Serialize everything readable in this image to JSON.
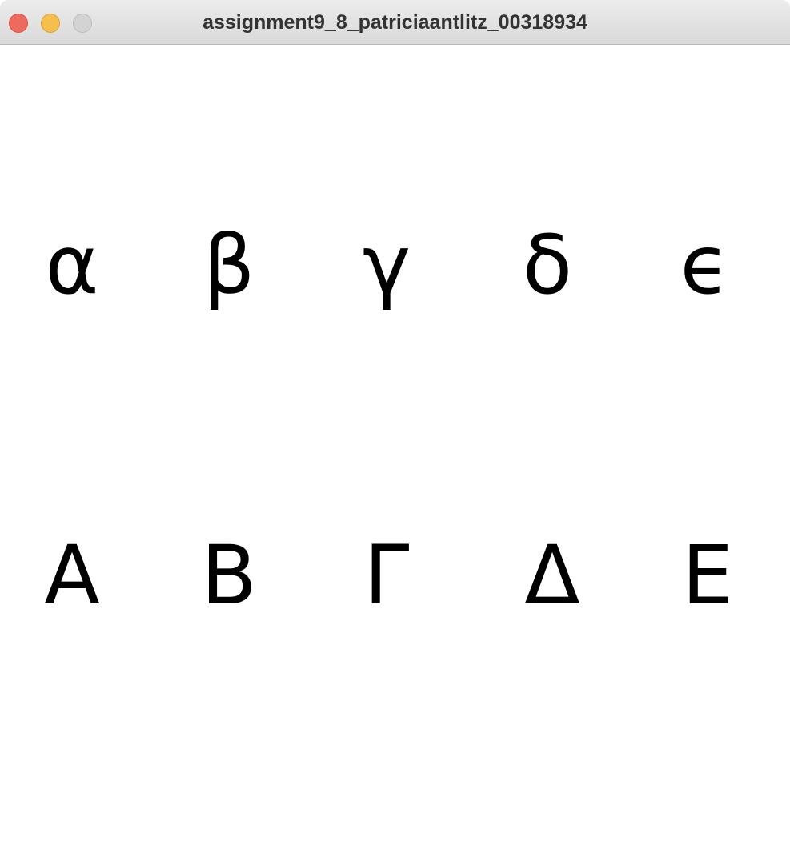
{
  "window": {
    "title": "assignment9_8_patriciaantlitz_00318934",
    "controls": [
      "close",
      "minimize",
      "zoom"
    ]
  },
  "canvas": {
    "lowercase": [
      "α",
      "β",
      "γ",
      "δ",
      "ϵ"
    ],
    "uppercase": [
      "Α",
      "Β",
      "Γ",
      "Δ",
      "Ε"
    ]
  },
  "colors": {
    "close": "#ee6a5e",
    "minimize": "#f5bf4f",
    "zoom": "#d3d3d3",
    "glyph": "#000000",
    "background": "#ffffff"
  }
}
